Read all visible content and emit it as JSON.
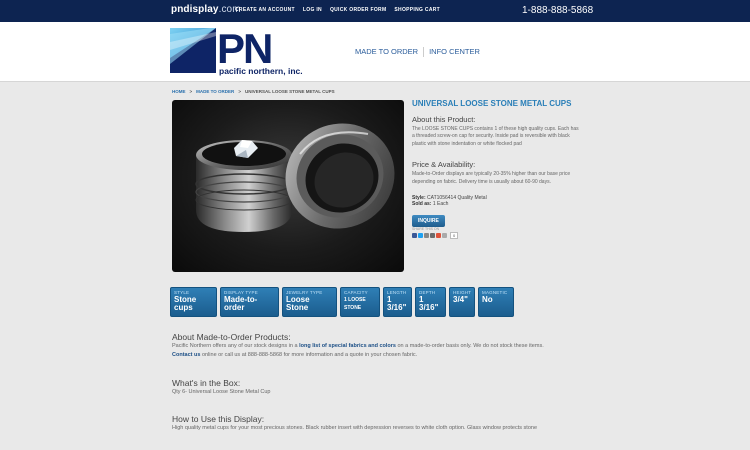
{
  "topbar": {
    "site_brand": "pndisplay",
    "site_domain": ".com",
    "nav": [
      "CREATE AN ACCOUNT",
      "LOG IN",
      "QUICK ORDER FORM",
      "SHOPPING CART"
    ],
    "phone": "1-888-888-5868"
  },
  "header": {
    "logo_text": "pacific northern, inc.",
    "logo_letters": "PN",
    "nav": [
      "MADE TO ORDER",
      "INFO CENTER"
    ]
  },
  "breadcrumb": {
    "home": "HOME",
    "sep": ">",
    "section": "MADE TO ORDER",
    "current": "UNIVERSAL LOOSE STONE METAL CUPS"
  },
  "product": {
    "title": "UNIVERSAL LOOSE STONE METAL CUPS",
    "about_heading": "About this Product:",
    "about_text": "The LOOSE STONE CUPS contains 1 of these high quality cups. Each has a threaded screw-on cap for security. Inside pad is reversible with black plastic with stone indentation or white flocked pad",
    "price_heading": "Price & Availability:",
    "price_text": "Made-to-Order displays are typically 20-35% higher than our base price depending on fabric. Delivery time is usually about 60-90 days.",
    "style_label": "Style:",
    "style_value": "CAT1056414 Quality Metal",
    "sold_label": "Sold as:",
    "sold_value": "1 Each",
    "inquire": "INQUIRE",
    "share_label": "SHARE THIS ON",
    "share_count": "0"
  },
  "attributes": [
    {
      "label": "STYLE",
      "value": "Stone cups",
      "small": false
    },
    {
      "label": "DISPLAY TYPE",
      "value": "Made-to-order",
      "small": false
    },
    {
      "label": "JEWELRY TYPE",
      "value": "Loose Stone",
      "small": false
    },
    {
      "label": "CAPACITY",
      "value": "1 LOOSE STONE",
      "small": true
    },
    {
      "label": "LENGTH",
      "value": "1 3/16\"",
      "small": false
    },
    {
      "label": "DEPTH",
      "value": "1 3/16\"",
      "small": false
    },
    {
      "label": "HEIGHT",
      "value": "3/4\"",
      "small": false
    },
    {
      "label": "MAGNETIC",
      "value": "No",
      "small": false
    }
  ],
  "sections": {
    "made": {
      "heading": "About Made-to-Order Products:",
      "t1": "Pacific Northern offers any of our stock designs in a ",
      "link1": "long list of special fabrics and colors",
      "t2": " on a made-to-order basis only. We do not stock these items.",
      "link2": "Contact us",
      "t3": " online or call us at 888-888-5868 for more information and a quote in your chosen fabric."
    },
    "box": {
      "heading": "What's in the Box:",
      "text": "Qty 6- Universal Loose Stone Metal Cup"
    },
    "use": {
      "heading": "How to Use this Display:",
      "text": "High quality metal cups for your most precious stones. Black rubber insert with depression reverses to white cloth option. Glass window protects stone"
    }
  },
  "colors": {
    "topbar": "#0d2451",
    "accent": "#2a7fb8",
    "tile": "#1f6a9e",
    "logo_navy": "#0e2466"
  }
}
